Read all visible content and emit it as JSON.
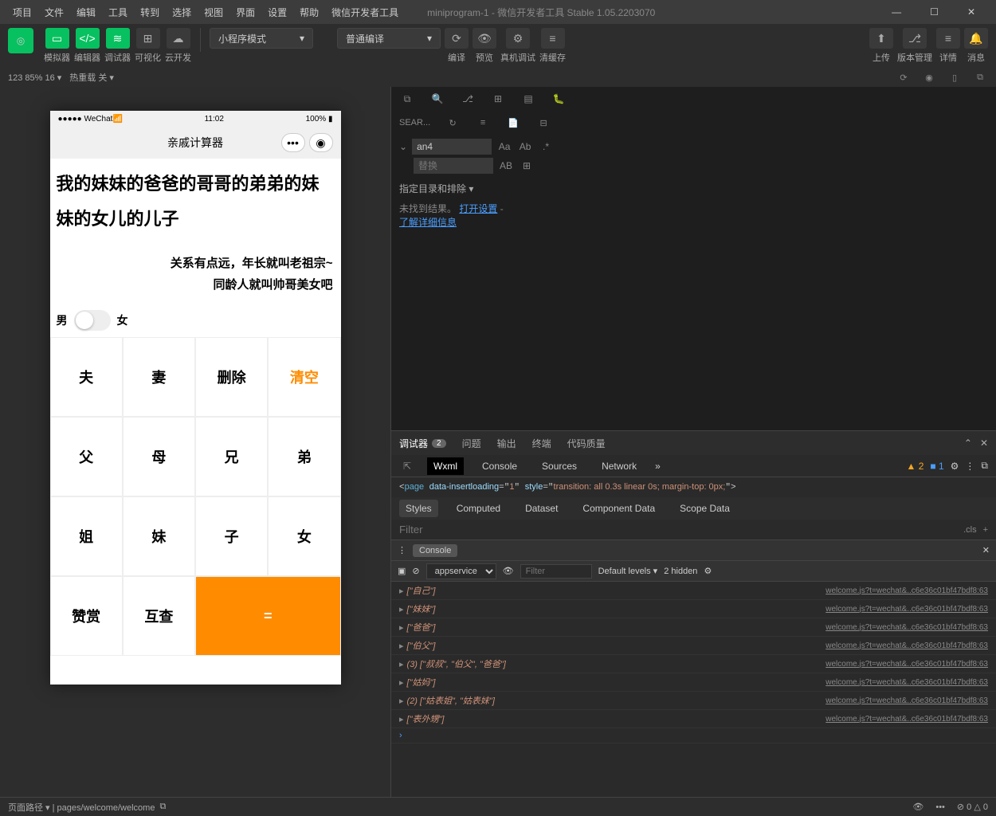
{
  "menubar": {
    "items": [
      "项目",
      "文件",
      "编辑",
      "工具",
      "转到",
      "选择",
      "视图",
      "界面",
      "设置",
      "帮助",
      "微信开发者工具"
    ],
    "title": "miniprogram-1 - 微信开发者工具 Stable 1.05.2203070"
  },
  "toolbar": {
    "labels": [
      "模拟器",
      "编辑器",
      "调试器",
      "可视化",
      "云开发"
    ],
    "mode": "小程序模式",
    "compile": "普通编译",
    "actions": [
      "编译",
      "预览",
      "真机调试",
      "清缓存"
    ],
    "right": [
      "上传",
      "版本管理",
      "详情",
      "消息"
    ]
  },
  "status": {
    "info": "123 85% 16 ▾",
    "reload": "热重载 关 ▾"
  },
  "phone": {
    "time": "11:02",
    "carrier": "WeChat",
    "battery": "100%",
    "title": "亲戚计算器",
    "input": "我的妹妹的爸爸的哥哥的弟弟的妹妹的女儿的儿子",
    "result1": "关系有点远，年长就叫老祖宗~",
    "result2": "同龄人就叫帅哥美女吧",
    "male": "男",
    "female": "女",
    "keys": [
      "夫",
      "妻",
      "删除",
      "清空",
      "父",
      "母",
      "兄",
      "弟",
      "姐",
      "妹",
      "子",
      "女",
      "赞赏",
      "互查",
      "="
    ]
  },
  "search": {
    "label": "SEAR...",
    "value": "an4",
    "replace": "替换",
    "exclude": "指定目录和排除 ▾",
    "noresult": "未找到结果。",
    "open": "打开设置",
    "learn": "了解详细信息"
  },
  "devtools": {
    "tabs": [
      "调试器",
      "问题",
      "输出",
      "终端",
      "代码质量"
    ],
    "badge": "2",
    "subtabs": [
      "Wxml",
      "Console",
      "Sources",
      "Network"
    ],
    "warns": "2",
    "infos": "1",
    "wxml": {
      "tag": "page",
      "attr1": "data-insertloading",
      "val1": "1",
      "attr2": "style",
      "val2": "transition: all 0.3s linear 0s; margin-top: 0px;"
    },
    "styletabs": [
      "Styles",
      "Computed",
      "Dataset",
      "Component Data",
      "Scope Data"
    ],
    "filter": "Filter",
    "cls": ".cls",
    "console": {
      "ctx": "appservice",
      "filter": "Filter",
      "levels": "Default levels ▾",
      "hidden": "2 hidden"
    },
    "logs": [
      {
        "t": "[\"自己\"]",
        "l": "welcome.js?t=wechat&..c6e36c01bf47bdf8:63"
      },
      {
        "t": "[\"妹妹\"]",
        "l": "welcome.js?t=wechat&..c6e36c01bf47bdf8:63"
      },
      {
        "t": "[\"爸爸\"]",
        "l": "welcome.js?t=wechat&..c6e36c01bf47bdf8:63"
      },
      {
        "t": "[\"伯父\"]",
        "l": "welcome.js?t=wechat&..c6e36c01bf47bdf8:63"
      },
      {
        "t": "(3) [\"叔叔\", \"伯父\", \"爸爸\"]",
        "l": "welcome.js?t=wechat&..c6e36c01bf47bdf8:63"
      },
      {
        "t": "[\"姑妈\"]",
        "l": "welcome.js?t=wechat&..c6e36c01bf47bdf8:63"
      },
      {
        "t": "(2) [\"姑表姐\", \"姑表妹\"]",
        "l": "welcome.js?t=wechat&..c6e36c01bf47bdf8:63"
      },
      {
        "t": "[\"表外甥\"]",
        "l": "welcome.js?t=wechat&..c6e36c01bf47bdf8:63"
      }
    ]
  },
  "bottom": {
    "path": "页面路径 ▾ | pages/welcome/welcome",
    "errors": "⊘ 0 △ 0"
  }
}
